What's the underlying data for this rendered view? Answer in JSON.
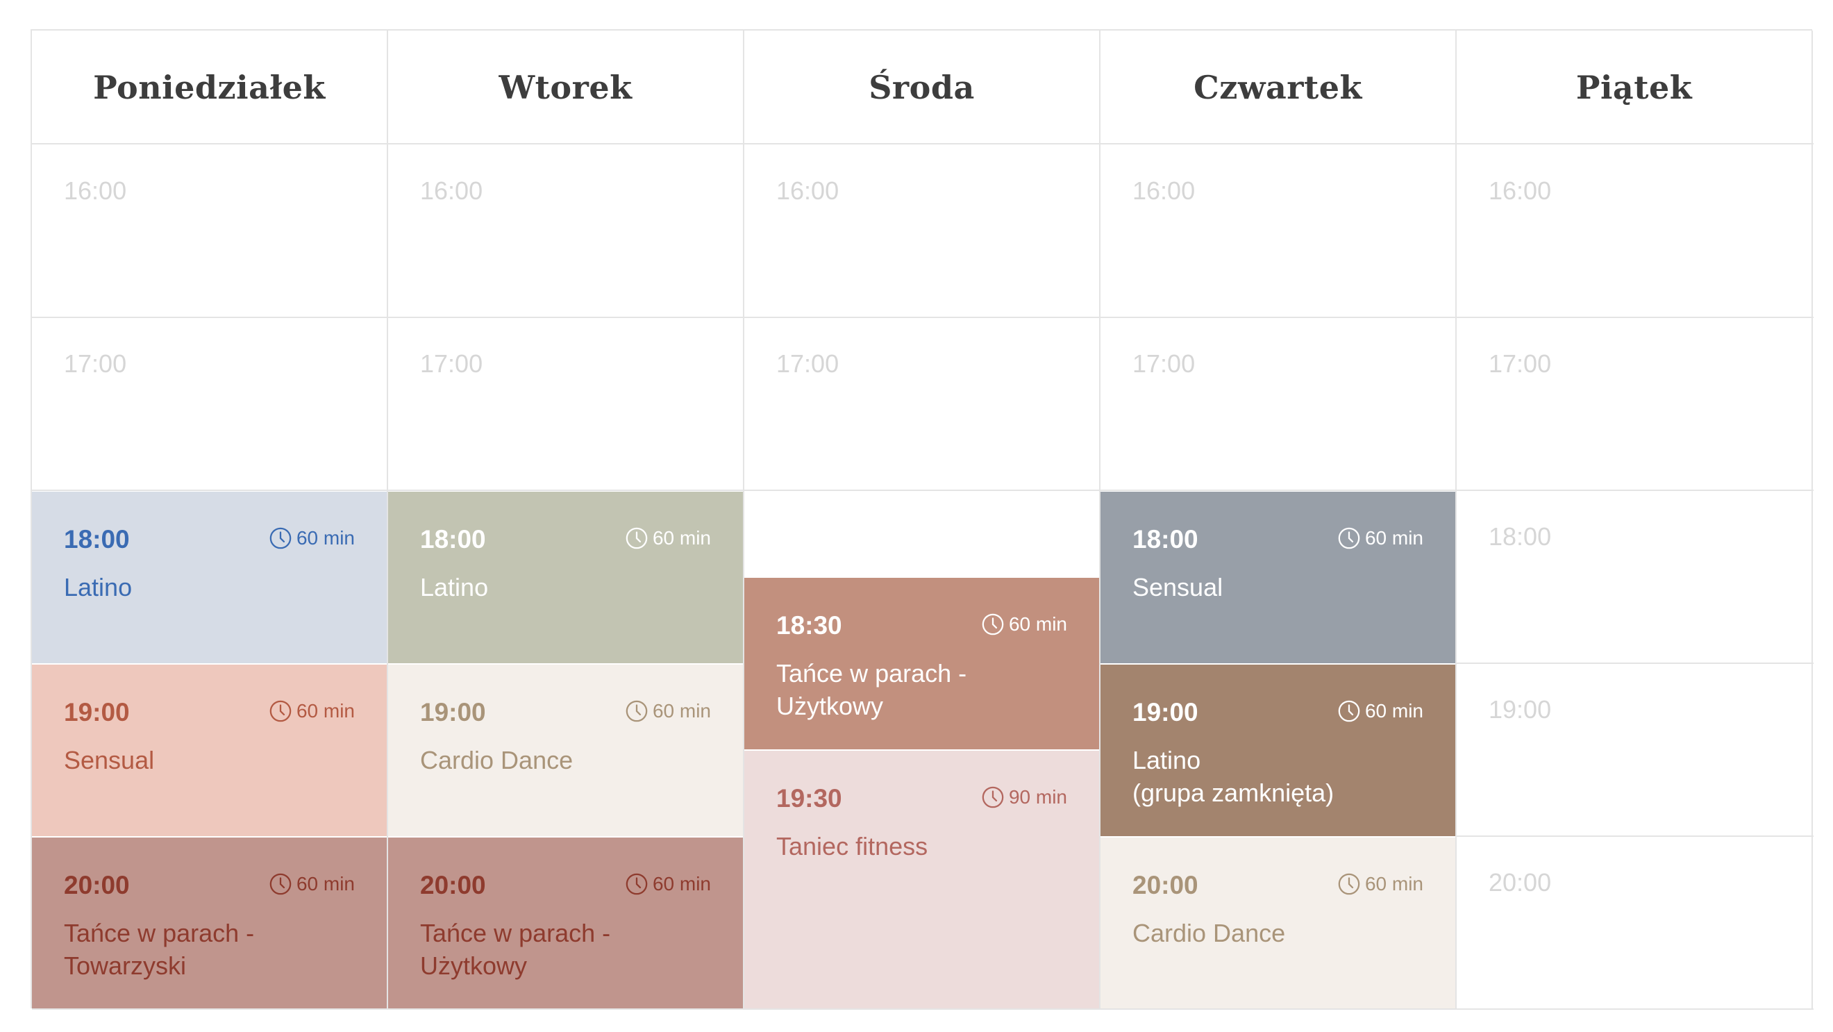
{
  "days": [
    "Poniedziałek",
    "Wtorek",
    "Środa",
    "Czwartek",
    "Piątek"
  ],
  "empty_slots": {
    "mon": [
      "16:00",
      "17:00"
    ],
    "tue": [
      "16:00",
      "17:00"
    ],
    "wed": [
      "16:00",
      "17:00"
    ],
    "thu": [
      "16:00",
      "17:00"
    ],
    "fri": [
      "16:00",
      "17:00",
      "18:00",
      "19:00",
      "20:00"
    ]
  },
  "classes": [
    {
      "day": "Poniedziałek",
      "time": "18:00",
      "duration": "60 min",
      "name": "Latino",
      "bg": "#d6dce6",
      "fg": "#3a6bb3",
      "icon": "clock-icon"
    },
    {
      "day": "Poniedziałek",
      "time": "19:00",
      "duration": "60 min",
      "name": "Sensual",
      "bg": "#eec8bd",
      "fg": "#b35a43",
      "icon": "clock-icon"
    },
    {
      "day": "Poniedziałek",
      "time": "20:00",
      "duration": "60 min",
      "name": "Tańce w parach -\nTowarzyski",
      "bg": "#c0958d",
      "fg": "#8e3b2e",
      "icon": "clock-icon"
    },
    {
      "day": "Wtorek",
      "time": "18:00",
      "duration": "60 min",
      "name": "Latino",
      "bg": "#c2c4b2",
      "fg": "#ffffff",
      "icon": "clock-icon"
    },
    {
      "day": "Wtorek",
      "time": "19:00",
      "duration": "60 min",
      "name": "Cardio Dance",
      "bg": "#f4efea",
      "fg": "#a99479",
      "icon": "clock-icon"
    },
    {
      "day": "Wtorek",
      "time": "20:00",
      "duration": "60 min",
      "name": "Tańce w parach -\nUżytkowy",
      "bg": "#c0958d",
      "fg": "#8e3b2e",
      "icon": "clock-icon"
    },
    {
      "day": "Środa",
      "time": "18:30",
      "duration": "60 min",
      "name": "Tańce w parach -\nUżytkowy",
      "bg": "#c2907e",
      "fg": "#ffffff",
      "icon": "clock-icon"
    },
    {
      "day": "Środa",
      "time": "19:30",
      "duration": "90 min",
      "name": "Taniec fitness",
      "bg": "#eddcdb",
      "fg": "#b3675f",
      "icon": "clock-icon"
    },
    {
      "day": "Czwartek",
      "time": "18:00",
      "duration": "60 min",
      "name": "Sensual",
      "bg": "#989fa8",
      "fg": "#ffffff",
      "icon": "clock-icon"
    },
    {
      "day": "Czwartek",
      "time": "19:00",
      "duration": "60 min",
      "name": "Latino\n(grupa zamknięta)",
      "bg": "#a3846e",
      "fg": "#ffffff",
      "icon": "clock-icon"
    },
    {
      "day": "Czwartek",
      "time": "20:00",
      "duration": "60 min",
      "name": "Cardio Dance",
      "bg": "#f4efea",
      "fg": "#a99479",
      "icon": "clock-icon"
    }
  ]
}
